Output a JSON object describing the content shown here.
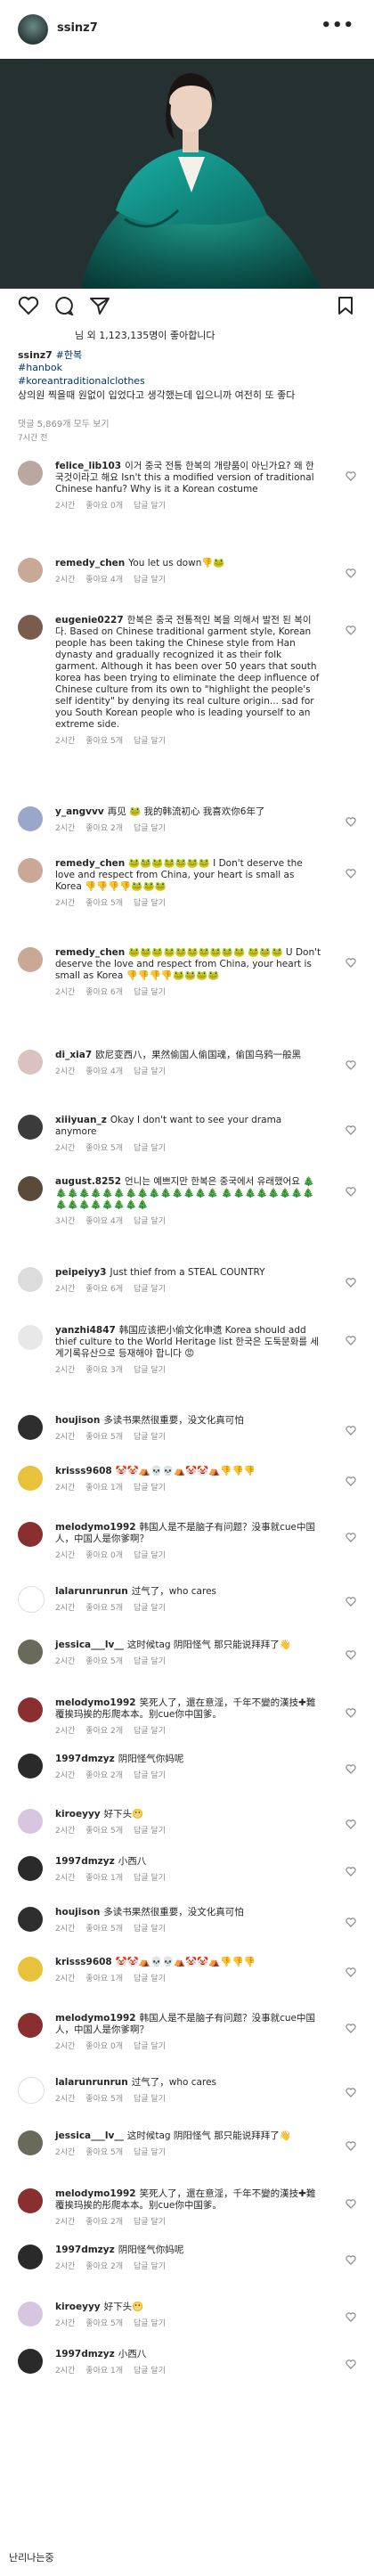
{
  "post": {
    "username": "ssinz7",
    "likes": "님 외 1,123,135명이 좋아합니다",
    "caption_user": "ssinz7",
    "hashtag_inline": "#한복",
    "hashtags": [
      "#hanbok",
      "#koreantraditionalclothes"
    ],
    "caption_text": "상의원 찍을때 원없이 입었다고 생각했는데 입으니까 여전히 또 좋다",
    "view_all": "댓글 5,869개 모두 보기",
    "time_ago": "7시간 전"
  },
  "comments": [
    {
      "user": "felice_lib103",
      "text": "이거 중국 전통 한복의 개량품이 아닌가요? 왜 한국것이라고 해요  Isn't this a modified version of traditional Chinese hanfu? Why is it a Korean costume",
      "time": "2시간",
      "likes": "좋아요 0개",
      "reply": "답글 달기",
      "avatar": "#b9a7a0"
    },
    {
      "user": "remedy_chen",
      "text": "You let us down👎🐸",
      "time": "2시간",
      "likes": "좋아요 4개",
      "reply": "답글 달기",
      "avatar": "#c9a896"
    },
    {
      "user": "eugenie0227",
      "text": "한복은 중국 전통적인 복을 의해서 발전 된 복이다. Based on Chinese traditional garment style, Korean people has been taking the Chinese style from Han dynasty and gradually recognized it as their folk garment. Although it has been over 50 years that south korea has been trying to eliminate the deep influence of Chinese culture from its own to \"highlight the people's self identity\" by denying its real culture origin... sad for you South Korean people who is leading yourself to an extreme side.",
      "time": "2시간",
      "likes": "좋아요 5개",
      "reply": "답글 달기",
      "avatar": "#7a5c4c"
    },
    {
      "user": "y_angvvv",
      "text": "再见 🐸 我的韩流初心 我喜欢你6年了",
      "time": "2시간",
      "likes": "좋아요 2개",
      "reply": "답글 달기",
      "avatar": "#9aa7c9"
    },
    {
      "user": "remedy_chen",
      "text": "🐸🐸🐸🐸🐸🐸🐸 I Don't deserve the love and respect from China, your heart is small as Korea 👎👎👎👎🐸🐸🐸",
      "time": "2시간",
      "likes": "좋아요 5개",
      "reply": "답글 달기",
      "avatar": "#c9a896"
    },
    {
      "user": "remedy_chen",
      "text": "🐸🐸🐸🐸🐸🐸🐸🐸🐸🐸 🐸🐸🐸 U Don't deserve the love and respect from China, your heart is small as Korea 👎👎👎👎🐸🐸🐸🐸",
      "time": "2시간",
      "likes": "좋아요 6개",
      "reply": "답글 달기",
      "avatar": "#c9a896"
    },
    {
      "user": "di_xia7",
      "text": "欧尼变西八，果然偷国人偷国魂，偷国乌鸦一般黑",
      "time": "2시간",
      "likes": "좋아요 4개",
      "reply": "답글 달기",
      "avatar": "#d9c2c0"
    },
    {
      "user": "xiiiyuan_z",
      "text": "Okay I don't want to see your drama anymore",
      "time": "2시간",
      "likes": "좋아요 5개",
      "reply": "답글 달기",
      "avatar": "#3b3b3b"
    },
    {
      "user": "august.8252",
      "text": "언니는 예쁘지만 한복은 중국에서 유래했어요 🎄🎄🎄🎄🎄🎄🎄🎄🎄🎄🎄🎄🎄🎄🎄 🎄🎄🎄🎄🎄🎄🎄🎄🎄🎄🎄🎄🎄🎄🎄🎄",
      "time": "3시간",
      "likes": "좋아요 4개",
      "reply": "답글 달기",
      "avatar": "#5a4a3a"
    },
    {
      "user": "peipeiyy3",
      "text": "Just thief from a STEAL COUNTRY",
      "time": "2시간",
      "likes": "좋아요 6개",
      "reply": "답글 달기",
      "avatar": "#dcdcdc"
    },
    {
      "user": "yanzhi4847",
      "text": "韩国应该把小偷文化申遗 Korea should add thief culture to the World Heritage list 한국은 도둑문화를 세계기록유산으로 등재해야 합니다 😡",
      "time": "2시간",
      "likes": "좋아요 3개",
      "reply": "답글 달기",
      "avatar": "#e8e8e8"
    },
    {
      "user": "houjison",
      "text": "多读书果然很重要，没文化真可怕",
      "time": "2시간",
      "likes": "좋아요 5개",
      "reply": "답글 달기",
      "avatar": "#2e2e2e"
    },
    {
      "user": "krisss9608",
      "text": "🤡🤡⛺💀💀⛺🤡🤡⛺👎👎👎",
      "time": "2시간",
      "likes": "좋아요 1개",
      "reply": "답글 달기",
      "avatar": "#e8c23a"
    },
    {
      "user": "melodymo1992",
      "text": "韩国人是不是脑子有问题？没事就cue中国人，中国人是你爹啊？",
      "time": "2시간",
      "likes": "좋아요 0개",
      "reply": "답글 달기",
      "avatar": "#8a2f2f"
    },
    {
      "user": "lalarunrunrun",
      "text": "过气了，who cares",
      "time": "2시간",
      "likes": "좋아요 5개",
      "reply": "답글 달기",
      "avatar": "#ffffff"
    },
    {
      "user": "jessica___lv__",
      "text": "这时候tag 阴阳怪气 那只能说拜拜了👋",
      "time": "2시간",
      "likes": "좋아요 5개",
      "reply": "답글 달기",
      "avatar": "#6a6a5a"
    },
    {
      "user": "melodymo1992",
      "text": "笑死人了，還在意淫，千年不變的漢技✚難覆挨玛挨的彤爬本本。别cue你中国爹。",
      "time": "2시간",
      "likes": "좋아요 2개",
      "reply": "답글 달기",
      "avatar": "#8a2f2f"
    },
    {
      "user": "1997dmzyz",
      "text": "阴阳怪气你妈呢",
      "time": "2시간",
      "likes": "좋아요 2개",
      "reply": "답글 달기",
      "avatar": "#2a2a2a"
    },
    {
      "user": "kiroeyyy",
      "text": "好下头😬",
      "time": "2시간",
      "likes": "좋아요 5개",
      "reply": "답글 달기",
      "avatar": "#d8c6e0"
    },
    {
      "user": "1997dmzyz",
      "text": "小西八",
      "time": "2시간",
      "likes": "좋아요 1개",
      "reply": "답글 달기",
      "avatar": "#2a2a2a"
    },
    {
      "user": "houjison",
      "text": "多读书果然很重要，没文化真可怕",
      "time": "2시간",
      "likes": "좋아요 5개",
      "reply": "답글 달기",
      "avatar": "#2e2e2e"
    },
    {
      "user": "krisss9608",
      "text": "🤡🤡⛺💀💀⛺🤡🤡⛺👎👎👎",
      "time": "2시간",
      "likes": "좋아요 1개",
      "reply": "답글 달기",
      "avatar": "#e8c23a"
    },
    {
      "user": "melodymo1992",
      "text": "韩国人是不是脑子有问题？没事就cue中国人，中国人是你爹啊？",
      "time": "2시간",
      "likes": "좋아요 0개",
      "reply": "답글 달기",
      "avatar": "#8a2f2f"
    },
    {
      "user": "lalarunrunrun",
      "text": "过气了，who cares",
      "time": "2시간",
      "likes": "좋아요 5개",
      "reply": "답글 달기",
      "avatar": "#ffffff"
    },
    {
      "user": "jessica___lv__",
      "text": "这时候tag 阴阳怪气 那只能说拜拜了👋",
      "time": "2시간",
      "likes": "좋아요 5개",
      "reply": "답글 달기",
      "avatar": "#6a6a5a"
    },
    {
      "user": "melodymo1992",
      "text": "笑死人了，還在意淫，千年不變的漢技✚難覆挨玛挨的彤爬本本。别cue你中国爹。",
      "time": "2시간",
      "likes": "좋아요 2개",
      "reply": "답글 달기",
      "avatar": "#8a2f2f"
    },
    {
      "user": "1997dmzyz",
      "text": "阴阳怪气你妈呢",
      "time": "2시간",
      "likes": "좋아요 2개",
      "reply": "답글 달기",
      "avatar": "#2a2a2a"
    },
    {
      "user": "kiroeyyy",
      "text": "好下头😬",
      "time": "2시간",
      "likes": "좋아요 5개",
      "reply": "답글 달기",
      "avatar": "#d8c6e0"
    },
    {
      "user": "1997dmzyz",
      "text": "小西八",
      "time": "2시간",
      "likes": "좋아요 1개",
      "reply": "답글 달기",
      "avatar": "#2a2a2a"
    }
  ],
  "footer": "난리나는중"
}
